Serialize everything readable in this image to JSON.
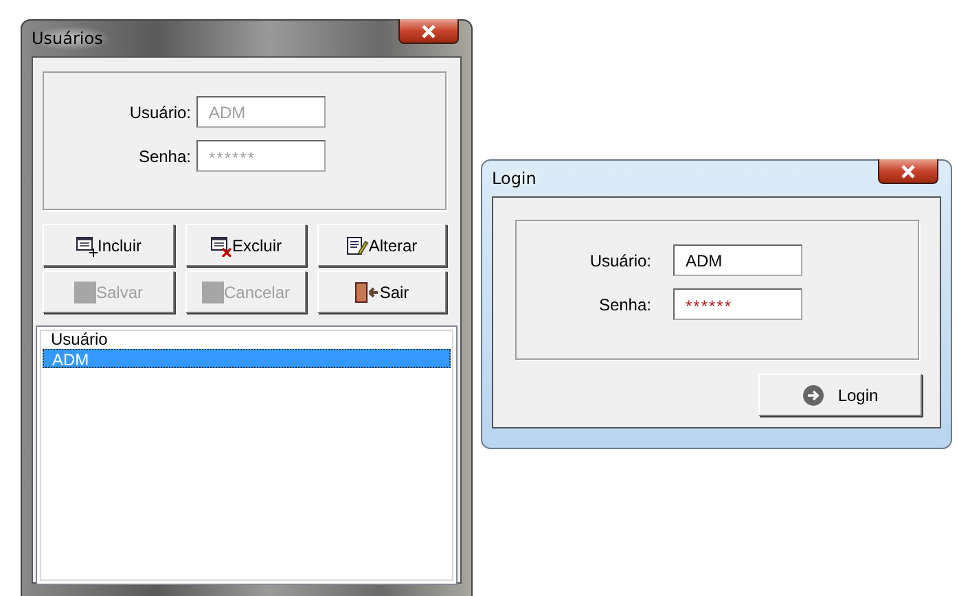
{
  "users_window": {
    "title": "Usuários",
    "fields": [
      {
        "label": "Usuário:",
        "value": "ADM",
        "disabled": true,
        "kind": "text"
      },
      {
        "label": "Senha:",
        "value": "******",
        "disabled": true,
        "kind": "password"
      }
    ],
    "buttons": [
      {
        "label": "Incluir",
        "kind": "add",
        "disabled": false
      },
      {
        "label": "Excluir",
        "kind": "delete",
        "disabled": false
      },
      {
        "label": "Alterar",
        "kind": "edit",
        "disabled": false
      },
      {
        "label": "Salvar",
        "kind": "blank",
        "disabled": true
      },
      {
        "label": "Cancelar",
        "kind": "blank",
        "disabled": true
      },
      {
        "label": "Sair",
        "kind": "exit",
        "disabled": false
      }
    ],
    "list": {
      "header": "Usuário",
      "rows": [
        {
          "text": "ADM",
          "selected": true
        }
      ]
    }
  },
  "login_window": {
    "title": "Login",
    "fields": [
      {
        "label": "Usuário:",
        "value": "ADM",
        "disabled": false,
        "kind": "text"
      },
      {
        "label": "Senha:",
        "value": "******",
        "disabled": false,
        "kind": "password"
      }
    ],
    "button": {
      "label": "Login",
      "kind": "go"
    }
  }
}
